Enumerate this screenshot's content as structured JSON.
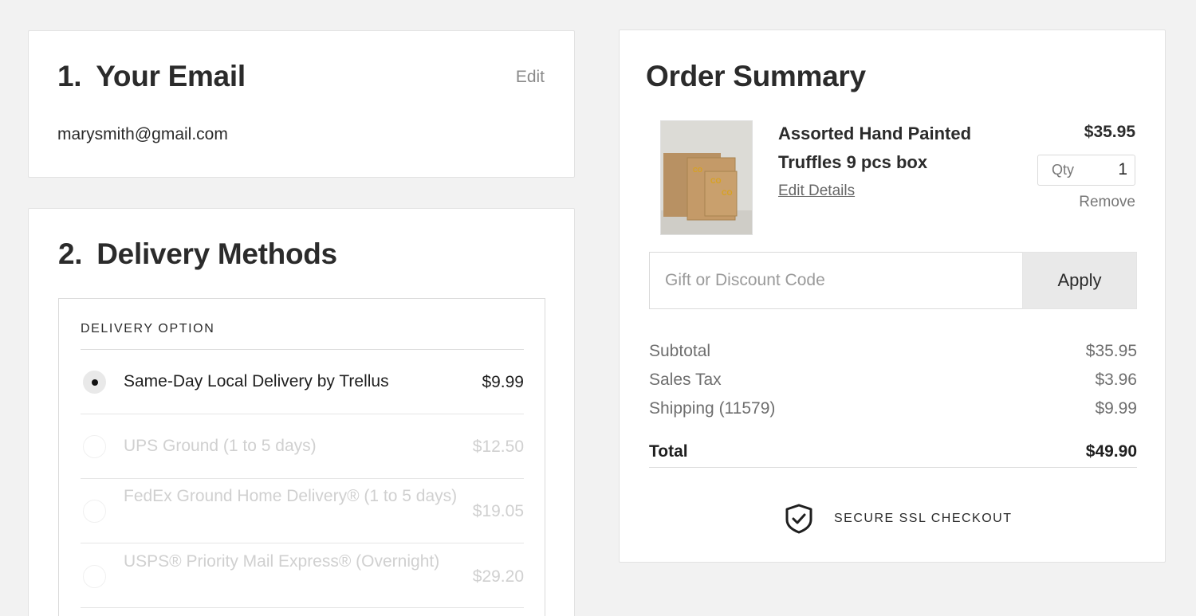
{
  "email_section": {
    "number": "1.",
    "title": "Your Email",
    "edit_label": "Edit",
    "email": "marysmith@gmail.com"
  },
  "delivery_section": {
    "number": "2.",
    "title": "Delivery Methods",
    "options_header": "DELIVERY OPTION",
    "options": [
      {
        "label": "Same-Day Local Delivery by Trellus",
        "price": "$9.99",
        "selected": true,
        "enabled": true
      },
      {
        "label": "UPS Ground (1 to 5 days)",
        "price": "$12.50",
        "selected": false,
        "enabled": false
      },
      {
        "label": "FedEx Ground Home Delivery® (1 to 5 days)",
        "price": "$19.05",
        "selected": false,
        "enabled": false
      },
      {
        "label": "USPS® Priority Mail Express® (Overnight)",
        "price": "$29.20",
        "selected": false,
        "enabled": false
      }
    ]
  },
  "order_summary": {
    "title": "Order Summary",
    "item": {
      "name": "Assorted Hand Painted Truffles 9 pcs box",
      "price": "$35.95",
      "edit_details_label": "Edit Details",
      "qty_label": "Qty",
      "qty_value": "1",
      "remove_label": "Remove",
      "image_icon": "product-photo"
    },
    "discount": {
      "placeholder": "Gift or Discount Code",
      "apply_label": "Apply"
    },
    "totals": {
      "subtotal_label": "Subtotal",
      "subtotal_value": "$35.95",
      "tax_label": "Sales Tax",
      "tax_value": "$3.96",
      "shipping_label": "Shipping (11579)",
      "shipping_value": "$9.99",
      "total_label": "Total",
      "total_value": "$49.90"
    },
    "secure_label": "SECURE SSL CHECKOUT",
    "secure_icon": "shield-check-icon"
  },
  "colors": {
    "page_background": "#f2f2f2",
    "card_background": "#ffffff",
    "text_primary": "#1f1f1f",
    "text_muted": "#6e6e6e",
    "text_disabled": "#d0d0d0",
    "button_background": "#e9e9e9"
  }
}
